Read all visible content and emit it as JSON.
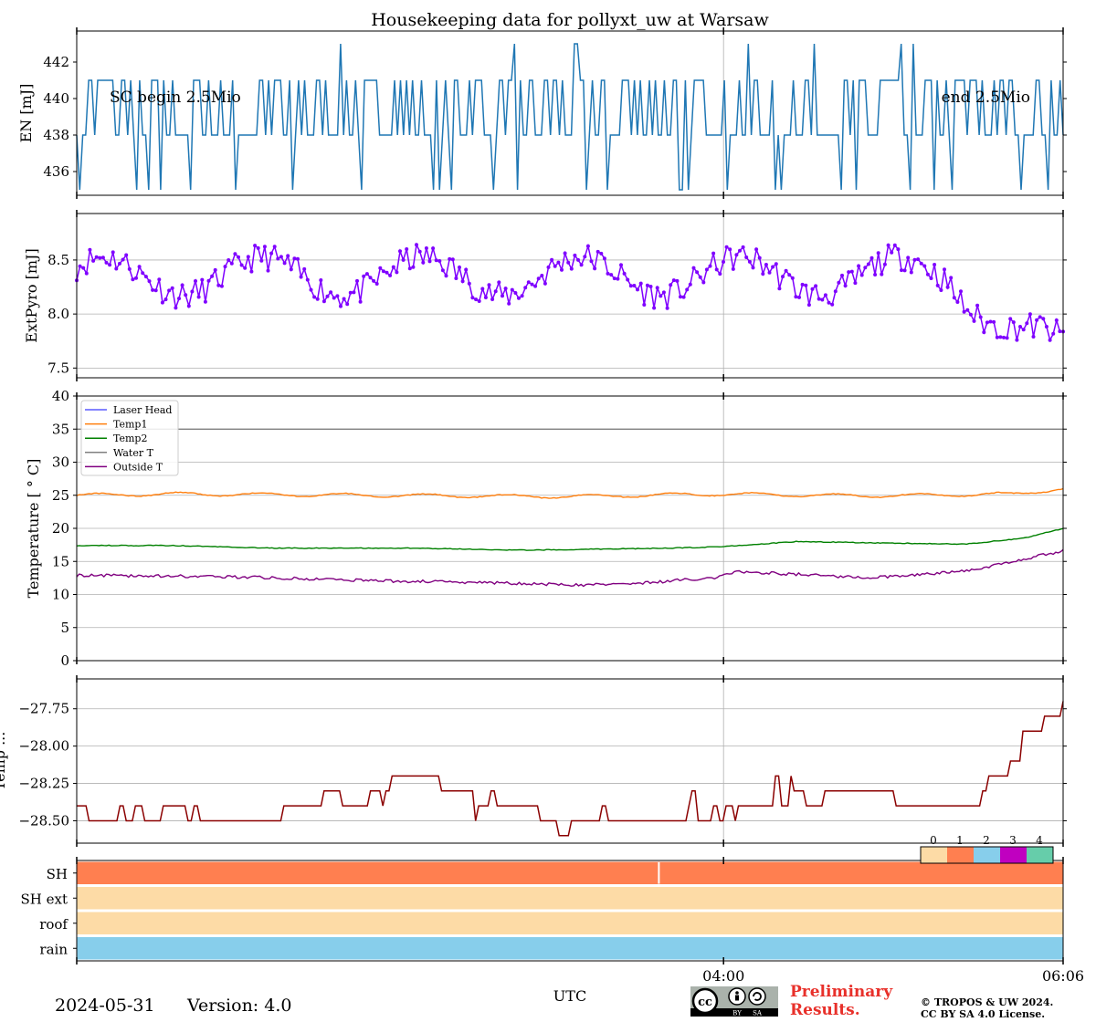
{
  "title": "Housekeeping data for pollyxt_uw at Warsaw",
  "footer": {
    "date": "2024-05-31",
    "version": "Version: 4.0",
    "preliminary_line1": "Preliminary",
    "preliminary_line2": "Results.",
    "copyright_line1": "© TROPOS & UW 2024.",
    "copyright_line2": "CC BY SA 4.0 License.",
    "license_badge": [
      "cc",
      "BY",
      "SA"
    ]
  },
  "chart_data": [
    {
      "type": "line",
      "name": "energy",
      "ylabel": "EN [mJ]",
      "ylim": [
        434.7,
        443.7
      ],
      "yticks": [
        436,
        438,
        440,
        442
      ],
      "color": "#1f77b4",
      "levels": [
        435,
        438,
        441,
        443
      ],
      "annotations": [
        "SC begin 2.5Mio",
        "end 2.5Mio"
      ],
      "grid": false
    },
    {
      "type": "line",
      "name": "extpyro",
      "ylabel": "ExtPyro [mJ]",
      "ylim": [
        7.41,
        8.93
      ],
      "yticks": [
        7.5,
        8.0,
        8.5
      ],
      "ytick_labels": [
        "7.5",
        "8.0",
        "8.5"
      ],
      "color": "#7f00ff",
      "markers": true,
      "grid": true
    },
    {
      "type": "line",
      "name": "temperatures",
      "ylabel": "Temperature [ ° C]",
      "ylim": [
        0,
        40
      ],
      "yticks": [
        0,
        5,
        10,
        15,
        20,
        25,
        30,
        35,
        40
      ],
      "legend_position": "upper-left",
      "grid": true,
      "series": [
        {
          "name": "Laser Head",
          "color": "#5a5aff",
          "constant": null
        },
        {
          "name": "Temp1",
          "color": "#ff7f0e",
          "keypoints": [
            [
              0,
              25.0
            ],
            [
              0.1,
              25.2
            ],
            [
              0.3,
              25.0
            ],
            [
              0.5,
              24.8
            ],
            [
              0.65,
              25.2
            ],
            [
              0.8,
              24.9
            ],
            [
              0.95,
              25.2
            ],
            [
              1.0,
              26.0
            ]
          ]
        },
        {
          "name": "Temp2",
          "color": "#008000",
          "keypoints": [
            [
              0,
              17.4
            ],
            [
              0.1,
              17.4
            ],
            [
              0.2,
              17.0
            ],
            [
              0.35,
              17.0
            ],
            [
              0.45,
              16.7
            ],
            [
              0.5,
              16.8
            ],
            [
              0.6,
              17.0
            ],
            [
              0.65,
              17.2
            ],
            [
              0.73,
              18.0
            ],
            [
              0.9,
              17.6
            ],
            [
              0.96,
              18.5
            ],
            [
              1.0,
              20.0
            ]
          ]
        },
        {
          "name": "Water T",
          "color": "#808080",
          "constant": 35.0
        },
        {
          "name": "Outside T",
          "color": "#800080",
          "keypoints": [
            [
              0,
              12.9
            ],
            [
              0.15,
              12.7
            ],
            [
              0.3,
              12.1
            ],
            [
              0.45,
              11.7
            ],
            [
              0.5,
              11.4
            ],
            [
              0.57,
              11.7
            ],
            [
              0.65,
              12.6
            ],
            [
              0.67,
              13.5
            ],
            [
              0.8,
              12.5
            ],
            [
              0.9,
              13.5
            ],
            [
              0.95,
              15.0
            ],
            [
              1.0,
              16.6
            ]
          ]
        }
      ]
    },
    {
      "type": "line",
      "name": "laser-temp",
      "ylabel": "Temp ...",
      "ylim": [
        -28.65,
        -27.55
      ],
      "yticks": [
        -28.5,
        -28.25,
        -28.0,
        -27.75
      ],
      "ytick_labels": [
        "−28.50",
        "−28.25",
        "−28.00",
        "−27.75"
      ],
      "color": "#8b0000",
      "grid": true
    },
    {
      "type": "heatmap",
      "name": "status-flags",
      "rows": [
        "SH",
        "SH ext",
        "roof",
        "rain"
      ],
      "row_status": [
        1,
        0,
        0,
        2
      ],
      "colorbar": {
        "labels": [
          "0",
          "1",
          "2",
          "3",
          "4"
        ],
        "colors": [
          "#fddba6",
          "#ff7f50",
          "#87ceeb",
          "#c000c0",
          "#66cdaa"
        ]
      }
    }
  ],
  "time_axis": {
    "xlabel": "UTC",
    "range_hours": [
      0,
      6.1
    ],
    "ticks": [
      {
        "hour": 4.0,
        "label": "04:00"
      },
      {
        "hour": 6.1,
        "label": "06:06"
      }
    ]
  }
}
